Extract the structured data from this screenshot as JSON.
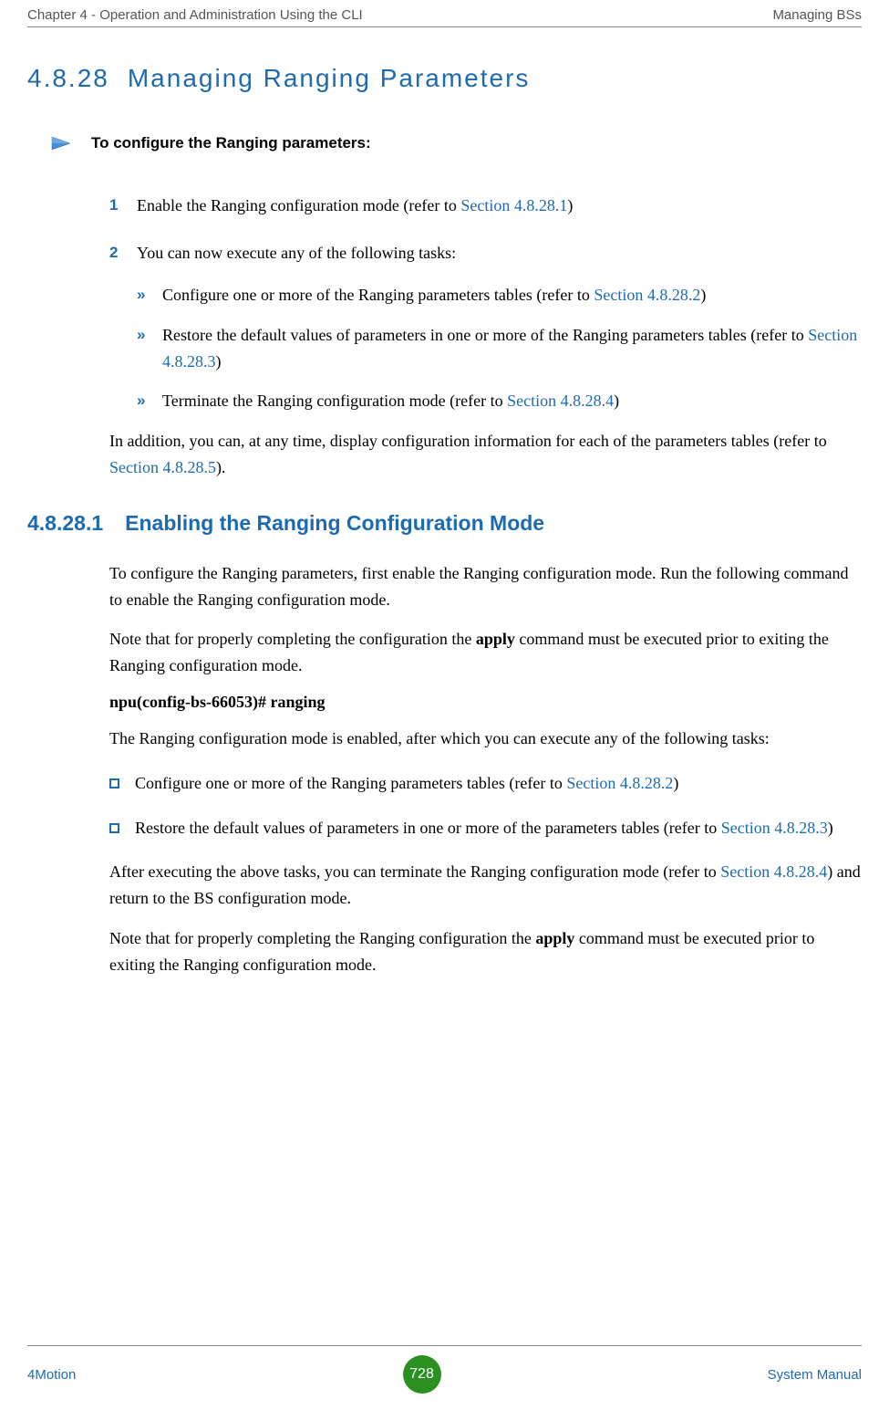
{
  "header": {
    "left": "Chapter 4 - Operation and Administration Using the CLI",
    "right": "Managing BSs"
  },
  "section": {
    "number": "4.8.28",
    "title": "Managing Ranging Parameters"
  },
  "callout": {
    "text": "To configure the Ranging parameters:"
  },
  "step1": {
    "num": "1",
    "text_a": "Enable the Ranging configuration mode (refer to ",
    "link": "Section 4.8.28.1",
    "text_b": ")"
  },
  "step2": {
    "num": "2",
    "text": "You can now execute any of the following tasks:"
  },
  "sub1": {
    "text_a": "Configure one or more of the Ranging parameters tables (refer to ",
    "link": "Section 4.8.28.2",
    "text_b": ")"
  },
  "sub2": {
    "text_a": "Restore the default values of parameters in one or more of the Ranging parameters tables (refer to ",
    "link": "Section 4.8.28.3",
    "text_b": ")"
  },
  "sub3": {
    "text_a": " Terminate the Ranging configuration mode (refer to ",
    "link": "Section 4.8.28.4",
    "text_b": ")"
  },
  "addition": {
    "text_a": "In addition, you can, at any time, display configuration information for each of the parameters tables (refer to ",
    "link": "Section 4.8.28.5",
    "text_b": ")."
  },
  "subsection": {
    "number": "4.8.28.1",
    "title": "Enabling the Ranging Configuration Mode"
  },
  "p1": "To configure the Ranging parameters, first enable the Ranging configuration mode. Run the following command to enable the Ranging configuration mode.",
  "p2_a": "Note that for properly completing the configuration the ",
  "p2_bold": "apply",
  "p2_b": " command must be executed prior to exiting the Ranging configuration mode.",
  "code": "npu(config-bs-66053)# ranging",
  "p3": "The Ranging configuration mode is enabled, after which you can execute any of the following tasks:",
  "bullet1": {
    "text_a": "Configure one or more of the Ranging parameters tables (refer to ",
    "link": "Section 4.8.28.2",
    "text_b": ")"
  },
  "bullet2": {
    "text_a": "Restore the default values of parameters in one or more of the parameters tables (refer to ",
    "link": "Section 4.8.28.3",
    "text_b": ")"
  },
  "p4_a": "After executing the above tasks, you can terminate the Ranging configuration mode (refer to ",
  "p4_link": "Section 4.8.28.4",
  "p4_b": ") and return to the BS configuration mode.",
  "p5_a": "Note that for properly completing the Ranging configuration the ",
  "p5_bold": "apply",
  "p5_b": " command must be executed prior to exiting the Ranging configuration mode.",
  "footer": {
    "left": "4Motion",
    "page": "728",
    "right": "System Manual"
  }
}
